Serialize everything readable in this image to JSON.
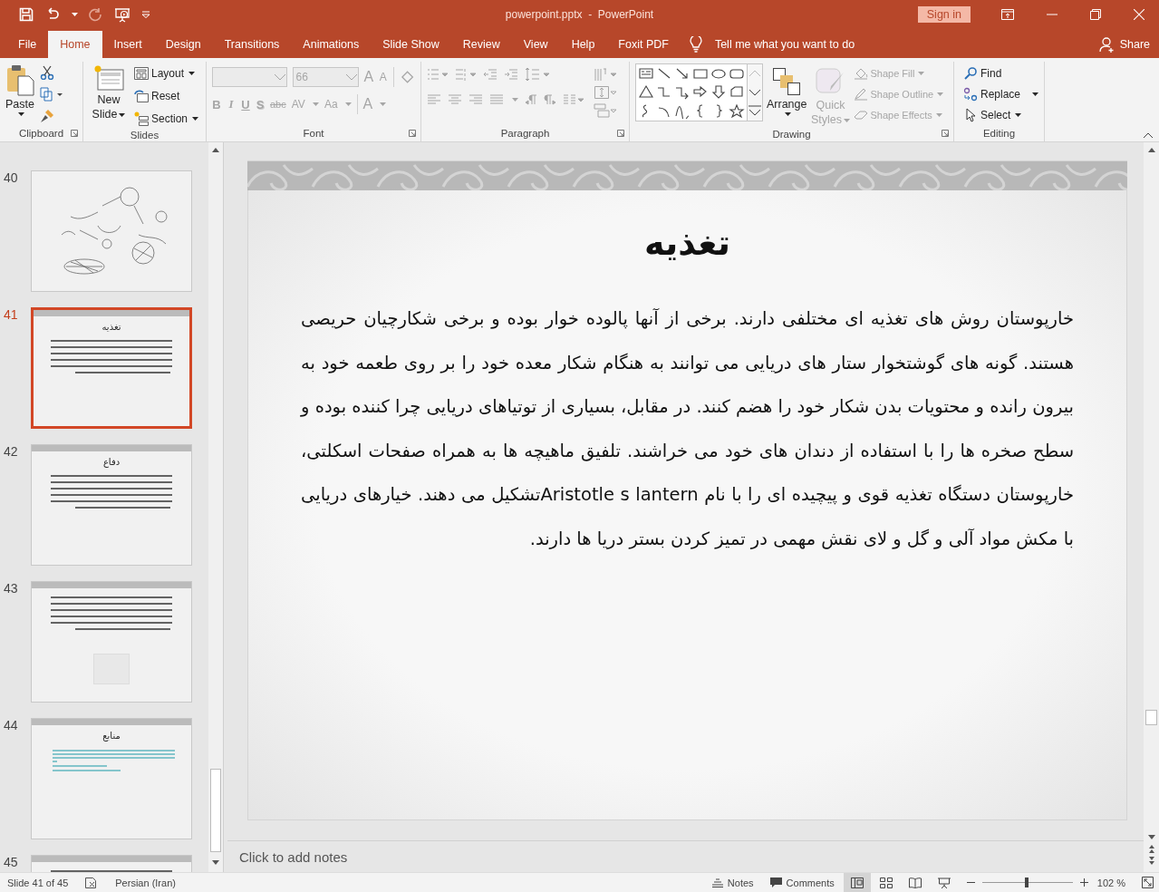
{
  "title_bar": {
    "title": "powerpoint.pptx  -  PowerPoint",
    "sign_in": "Sign in"
  },
  "menu_tabs": [
    {
      "label": "File",
      "selected": false
    },
    {
      "label": "Home",
      "selected": true
    },
    {
      "label": "Insert",
      "selected": false
    },
    {
      "label": "Design",
      "selected": false
    },
    {
      "label": "Transitions",
      "selected": false
    },
    {
      "label": "Animations",
      "selected": false
    },
    {
      "label": "Slide Show",
      "selected": false
    },
    {
      "label": "Review",
      "selected": false
    },
    {
      "label": "View",
      "selected": false
    },
    {
      "label": "Help",
      "selected": false
    },
    {
      "label": "Foxit PDF",
      "selected": false
    }
  ],
  "tell_me": {
    "placeholder": "Tell me what you want to do"
  },
  "share": "Share",
  "ribbon": {
    "clipboard": {
      "label": "Clipboard",
      "paste": "Paste"
    },
    "slides": {
      "label": "Slides",
      "new_slide": "New Slide",
      "layout": "Layout",
      "reset": "Reset",
      "section": "Section"
    },
    "font": {
      "label": "Font",
      "disabled": true,
      "font_size": "66",
      "grow": "A",
      "shrink": "A",
      "format_buttons": [
        "B",
        "I",
        "U",
        "S",
        "abc",
        "AV",
        "Aa",
        "A"
      ]
    },
    "paragraph": {
      "label": "Paragraph",
      "disabled": true
    },
    "drawing": {
      "label": "Drawing",
      "arrange": "Arrange",
      "quick_styles": {
        "label": "Quick Styles",
        "disabled": true
      },
      "shape_commands": [
        {
          "label": "Shape Fill",
          "disabled": true
        },
        {
          "label": "Shape Outline",
          "disabled": true
        },
        {
          "label": "Shape Effects",
          "disabled": true
        }
      ]
    },
    "editing": {
      "label": "Editing",
      "find": "Find",
      "replace": "Replace",
      "select": "Select"
    }
  },
  "thumbnails": [
    {
      "number": "40",
      "kind": "diagram",
      "selected": false
    },
    {
      "number": "41",
      "kind": "text",
      "selected": true,
      "title": "تغذیه"
    },
    {
      "number": "42",
      "kind": "text",
      "selected": false,
      "title": "دفاع"
    },
    {
      "number": "43",
      "kind": "text-image",
      "selected": false
    },
    {
      "number": "44",
      "kind": "links",
      "selected": false,
      "title": "منابع"
    },
    {
      "number": "45",
      "kind": "text",
      "selected": false
    }
  ],
  "slide": {
    "title": "تغذیه",
    "body": "خارپوستان روش های تغذیه ای مختلفی دارند. برخی از آنها پالوده خوار بوده و برخی شکارچیان حریصی هستند. گونه های گوشتخوار ستار های دریایی می توانند به هنگام شکار معده خود را بر روی طعمه خود به بیرون رانده و محتویات بدن شکار خود را هضم کنند. در مقابل، بسیاری از توتیاهای دریایی چرا کننده بوده و سطح صخره ها را با استفاده از دندان های خود می خراشند. تلفیق ماهیچه ها به همراه صفحات اسکلتی، خارپوستان دستگاه تغذیه قوی و پیچیده ای را با نام  Aristotle s lanternتشکیل می دهند. خیارهای دریایی با مکش مواد آلی و گل و لای نقش مهمی در تمیز کردن بستر دریا ها دارند."
  },
  "notes": {
    "placeholder": "Click to add notes"
  },
  "status_bar": {
    "slide_counter": "Slide 41 of 45",
    "language": "Persian (Iran)",
    "notes": "Notes",
    "comments": "Comments",
    "views": [
      {
        "kind": "normal",
        "selected": true
      },
      {
        "kind": "sorter",
        "selected": false
      },
      {
        "kind": "reading",
        "selected": false
      },
      {
        "kind": "slideshow",
        "selected": false
      }
    ],
    "zoom": {
      "level": 0.49,
      "reading": "102 %"
    }
  }
}
